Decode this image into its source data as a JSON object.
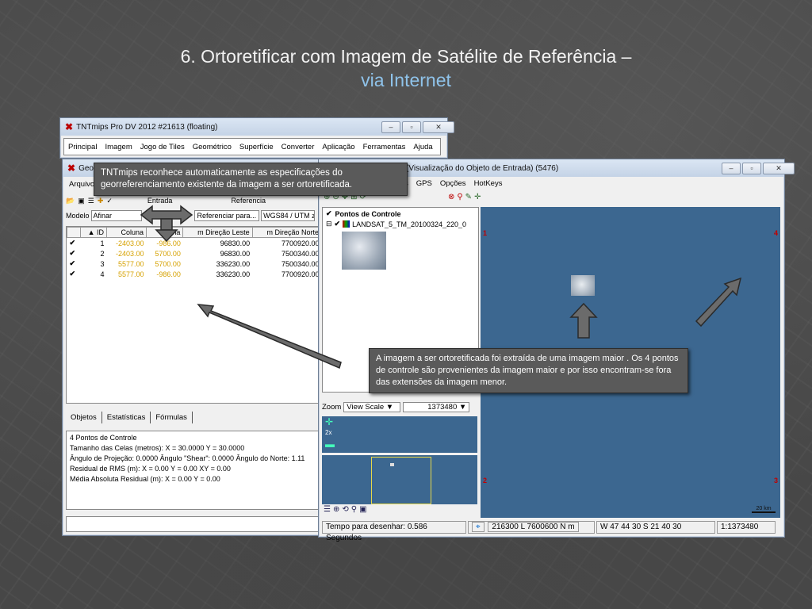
{
  "slide": {
    "title": "6. Ortoretificar com Imagem de Satélite de Referência –",
    "subtitle": "via Internet"
  },
  "main_window": {
    "title": "TNTmips Pro DV 2012  #21613 (floating)",
    "menu": [
      "Principal",
      "Imagem",
      "Jogo de Tiles",
      "Geométrico",
      "Superfície",
      "Converter",
      "Aplicação",
      "Ferramentas",
      "Ajuda"
    ]
  },
  "geo_window": {
    "title": "Georr",
    "menu_first": "Arquivo",
    "toolbar_entrada": "Entrada",
    "toolbar_referencia": "Referencia",
    "modelo_label": "Modelo",
    "modelo_value": "Afinar",
    "referenciar_button": "Referenciar para...",
    "projection": "WGS84 / UTM zo",
    "columns": [
      "ID",
      "Coluna",
      "Linha",
      "m Direção Leste",
      "m Direção Norte"
    ],
    "rows": [
      {
        "id": "1",
        "coluna": "-2403.00",
        "linha": "-986.00",
        "leste": "96830.00",
        "norte": "7700920.00"
      },
      {
        "id": "2",
        "coluna": "-2403.00",
        "linha": "5700.00",
        "leste": "96830.00",
        "norte": "7500340.00"
      },
      {
        "id": "3",
        "coluna": "5577.00",
        "linha": "5700.00",
        "leste": "336230.00",
        "norte": "7500340.00"
      },
      {
        "id": "4",
        "coluna": "5577.00",
        "linha": "-986.00",
        "leste": "336230.00",
        "norte": "7700920.00"
      }
    ],
    "tabs": [
      "Objetos",
      "Estatísticas",
      "Fórmulas"
    ],
    "stats": [
      "4 Pontos de Controle",
      "Tamanho das Celas (metros):  X = 30.0000  Y = 30.0000",
      "Ângulo de Projeção: 0.0000  Ângulo \"Shear\": 0.0000  Ângulo do Norte: 1.11",
      "Residual de RMS (m):  X = 0.00  Y = 0.00  XY = 0.00",
      "Média Absoluta Residual (m):  X = 0.00  Y = 0.00"
    ]
  },
  "view_window": {
    "title": "(Visualização do Objeto de Entrada) (5476)",
    "menu": [
      "s",
      "GPS",
      "Opções",
      "HotKeys"
    ],
    "layer1": "Pontos de Controle",
    "layer2": "LANDSAT_5_TM_20100324_220_0",
    "zoom_label": "Zoom",
    "zoom_mode": "View Scale",
    "zoom_value": "1373480",
    "zoom_2x": "2x",
    "scale_bar": "20 km",
    "status_time": "Tempo para desenhar: 0.586 Segundos",
    "status_coords": "216300 L  7600600 N m",
    "status_latlon": "W 47 44 30  S 21 40 30",
    "status_scale": "1:1373480",
    "markers": [
      "1",
      "4",
      "2",
      "3"
    ]
  },
  "callouts": {
    "top": "TNTmips reconhece automaticamente as especificações do georreferenciamento existente da imagem a ser ortoretificada.",
    "right": "A imagem a ser ortoretificada foi extraída de uma imagem maior . Os 4 pontos de controle são provenientes da imagem maior e por isso encontram-se fora das extensões da imagem menor."
  },
  "colors": {
    "map_blue": "#3c6790",
    "marker_red": "#c00000",
    "subtitle_blue": "#8fc3ea",
    "coluna_yellow": "#d6a100"
  }
}
